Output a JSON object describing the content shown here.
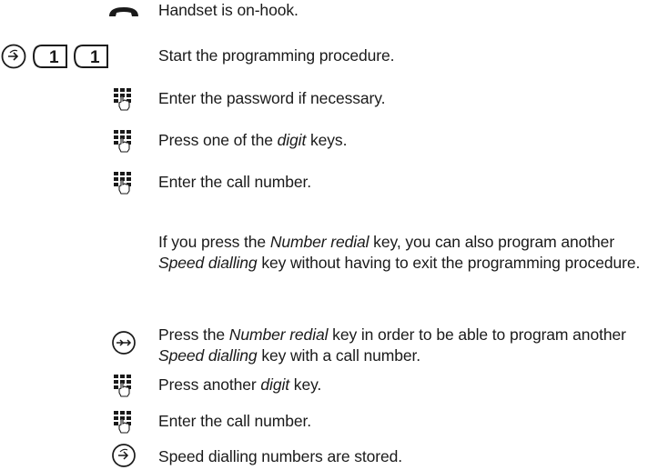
{
  "steps": [
    {
      "icon": "handset-on-hook-icon",
      "parts": [
        {
          "t": "Handset is on-hook."
        }
      ]
    },
    {
      "icon": "program-key-1-1-icon",
      "key_labels": [
        "1",
        "1"
      ],
      "parts": [
        {
          "t": "Start the programming procedure."
        }
      ]
    },
    {
      "icon": "keypad-hand-icon",
      "parts": [
        {
          "t": "Enter the password if necessary."
        }
      ]
    },
    {
      "icon": "keypad-hand-icon",
      "parts": [
        {
          "t": "Press one of the "
        },
        {
          "t": "digit",
          "i": true
        },
        {
          "t": " keys."
        }
      ]
    },
    {
      "icon": "keypad-hand-icon",
      "parts": [
        {
          "t": "Enter the call number."
        }
      ]
    },
    {
      "icon": "",
      "parts": [
        {
          "t": "If you press the "
        },
        {
          "t": "Number redial",
          "i": true
        },
        {
          "t": " key, you can also program another "
        },
        {
          "t": "Speed dialling",
          "i": true
        },
        {
          "t": " key without having to exit the programming procedure."
        }
      ]
    },
    {
      "icon": "number-redial-key-icon",
      "parts": [
        {
          "t": "Press the "
        },
        {
          "t": "Number redial",
          "i": true
        },
        {
          "t": " key in order to be able to program another "
        },
        {
          "t": "Speed dialling",
          "i": true
        },
        {
          "t": " key with a call number."
        }
      ]
    },
    {
      "icon": "keypad-hand-icon",
      "parts": [
        {
          "t": "Press another "
        },
        {
          "t": "digit",
          "i": true
        },
        {
          "t": " key."
        }
      ]
    },
    {
      "icon": "keypad-hand-icon",
      "parts": [
        {
          "t": "Enter the call number."
        }
      ]
    },
    {
      "icon": "program-key-icon",
      "parts": [
        {
          "t": "Speed dialling numbers are stored."
        }
      ]
    }
  ]
}
